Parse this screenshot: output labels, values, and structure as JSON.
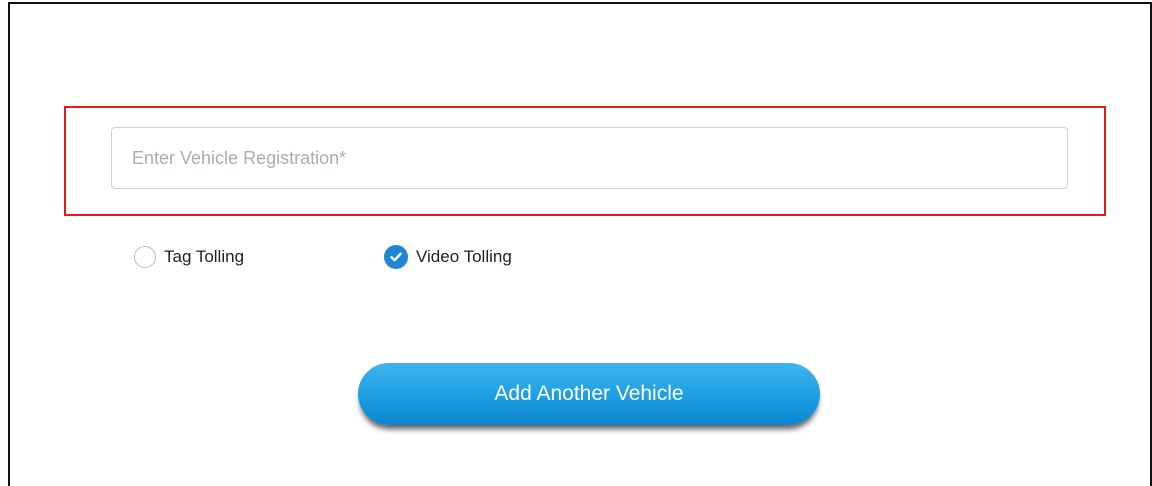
{
  "form": {
    "registration": {
      "value": "",
      "placeholder": "Enter Vehicle Registration*"
    },
    "tolling_options": [
      {
        "label": "Tag Tolling",
        "checked": false
      },
      {
        "label": "Video Tolling",
        "checked": true
      }
    ],
    "add_button_label": "Add Another Vehicle"
  },
  "colors": {
    "accent": "#1f88d4",
    "button_top": "#3fb4ec",
    "button_bottom": "#0d85cc",
    "highlight": "#e11b1b",
    "input_border": "#cfd3d7"
  },
  "icons": {
    "tag_tolling": "radio-unchecked-icon",
    "video_tolling": "radio-checked-icon"
  }
}
